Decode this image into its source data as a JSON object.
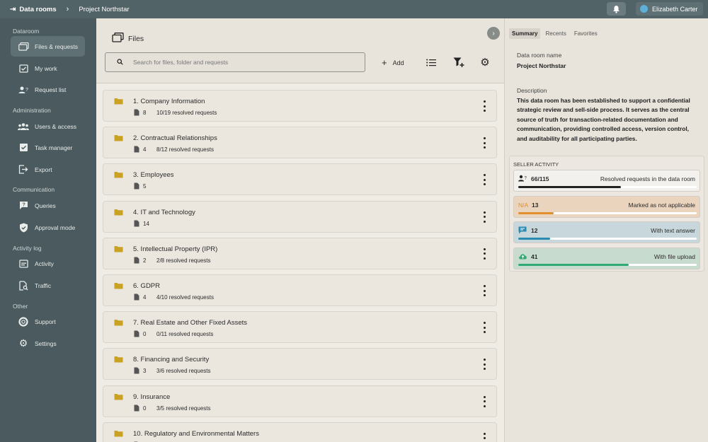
{
  "topbar": {
    "home_label": "Data rooms",
    "project_label": "Project Northstar",
    "user_name": "Elizabeth Carter"
  },
  "sidebar": {
    "sections": {
      "dataroom": "Dataroom",
      "administration": "Administration",
      "communication": "Communication",
      "activity_log": "Activity log",
      "other": "Other"
    },
    "items": {
      "files_requests": "Files & requests",
      "my_work": "My work",
      "request_list": "Request list",
      "users_access": "Users & access",
      "task_manager": "Task manager",
      "export": "Export",
      "queries": "Queries",
      "approval_mode": "Approval mode",
      "activity": "Activity",
      "traffic": "Traffic",
      "support": "Support",
      "settings": "Settings"
    }
  },
  "main": {
    "title": "Files",
    "search_placeholder": "Search for files, folder and requests",
    "add_label": "Add",
    "folders": [
      {
        "name": "1. Company Information",
        "count": "8",
        "resolved": "10/19 resolved requests"
      },
      {
        "name": "2. Contractual Relationships",
        "count": "4",
        "resolved": "8/12 resolved requests"
      },
      {
        "name": "3. Employees",
        "count": "5",
        "resolved": ""
      },
      {
        "name": "4. IT and Technology",
        "count": "14",
        "resolved": ""
      },
      {
        "name": "5. Intellectual Property (IPR)",
        "count": "2",
        "resolved": "2/8 resolved requests"
      },
      {
        "name": "6. GDPR",
        "count": "4",
        "resolved": "4/10 resolved requests"
      },
      {
        "name": "7. Real Estate and Other Fixed Assets",
        "count": "0",
        "resolved": "0/11 resolved requests"
      },
      {
        "name": "8. Financing and Security",
        "count": "3",
        "resolved": "3/6 resolved requests"
      },
      {
        "name": "9. Insurance",
        "count": "0",
        "resolved": "3/5 resolved requests"
      },
      {
        "name": "10. Regulatory and Environmental Matters",
        "count": "",
        "resolved": ""
      }
    ]
  },
  "right": {
    "tabs": [
      "Summary",
      "Recents",
      "Favorites"
    ],
    "name_label": "Data room name",
    "name_value": "Project Northstar",
    "desc_label": "Description",
    "desc_value": "This data room has been established to support a confidential strategic review and sell-side process. It serves as the central source of truth for transaction-related documentation and communication, providing controlled access, version control, and auditability for all participating parties.",
    "seller_title": "SELLER ACTIVITY",
    "stats": [
      {
        "icon": "person-question-icon",
        "prefix": "",
        "value": "66/115",
        "label": "Resolved requests in the data room",
        "progress": 0.574,
        "bg": "#f3f1ed",
        "bar": "#222222"
      },
      {
        "icon": "",
        "prefix": "N/A",
        "value": "13",
        "label": "Marked as not applicable",
        "progress": 0.2,
        "bg": "#ead4be",
        "bar": "#e0902e"
      },
      {
        "icon": "chat-icon",
        "prefix": "",
        "value": "12",
        "label": "With text answer",
        "progress": 0.18,
        "bg": "#c7d7db",
        "bar": "#2a8ab0"
      },
      {
        "icon": "cloud-upload-icon",
        "prefix": "",
        "value": "41",
        "label": "With file upload",
        "progress": 0.62,
        "bg": "#c7dccf",
        "bar": "#2eaa74"
      }
    ]
  }
}
